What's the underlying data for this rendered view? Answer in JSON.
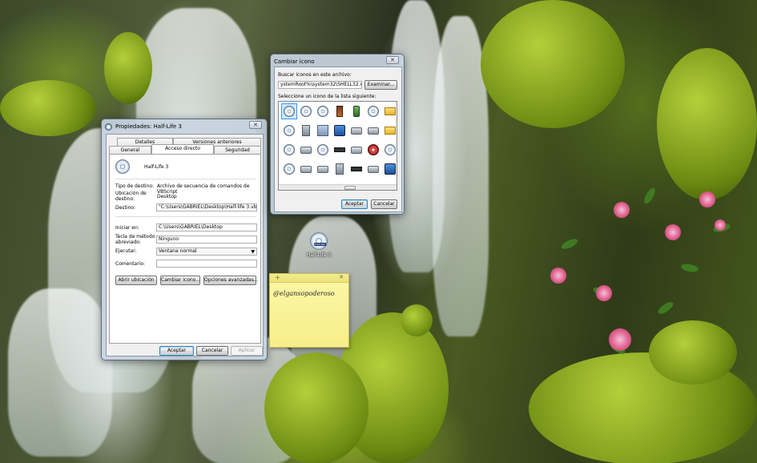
{
  "desktop": {
    "icon_label": "Half-Life 3",
    "disc_tag": "DVD-RW"
  },
  "properties_dialog": {
    "title": "Propiedades: Half-Life 3",
    "tabs_top": [
      "Detalles",
      "Versiones anteriores"
    ],
    "tabs_bottom": [
      "General",
      "Acceso directo",
      "Seguridad"
    ],
    "active_tab": "Acceso directo",
    "shortcut_name": "Half-Life 3",
    "fields": {
      "target_type_label": "Tipo de destino:",
      "target_type_value": "Archivo de secuencia de comandos de VBScript",
      "target_location_label": "Ubicación de destino:",
      "target_location_value": "Desktop",
      "target_label": "Destino:",
      "target_value": "\"C:\\Users\\GABRIEL\\Desktop\\Half-life 3.vbs\"",
      "start_in_label": "Iniciar en:",
      "start_in_value": "C:\\Users\\GABRIEL\\Desktop",
      "shortcut_key_label": "Tecla de método abreviado:",
      "shortcut_key_value": "Ninguno",
      "run_label": "Ejecutar:",
      "run_value": "Ventana normal",
      "comment_label": "Comentario:",
      "comment_value": ""
    },
    "buttons": {
      "open_location": "Abrir ubicación",
      "change_icon": "Cambiar icono...",
      "advanced": "Opciones avanzadas...",
      "ok": "Aceptar",
      "cancel": "Cancelar",
      "apply": "Aplicar"
    }
  },
  "change_icon_dialog": {
    "title": "Cambiar icono",
    "search_label": "Buscar iconos en este archivo:",
    "path_value": "ystemRoot%\\system32\\SHELL32.dll",
    "browse": "Examinar...",
    "list_label": "Seleccione un icono de la lista siguiente:",
    "ok": "Aceptar",
    "cancel": "Cancelar"
  },
  "sticky_note": {
    "text": "@elgansopoderoso"
  },
  "colors": {
    "selection": "#3399ff",
    "sticky": "#f7ee8a",
    "window_frame": "#c8d4e1"
  }
}
